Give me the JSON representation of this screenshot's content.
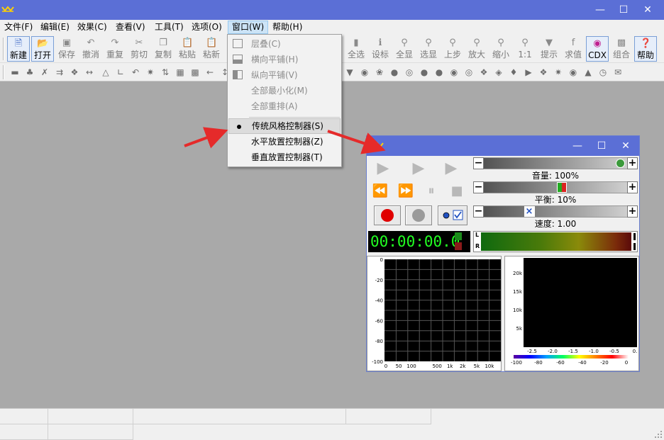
{
  "menubar": {
    "items": [
      "文件(F)",
      "编辑(E)",
      "效果(C)",
      "查看(V)",
      "工具(T)",
      "选项(O)",
      "窗口(W)",
      "帮助(H)"
    ]
  },
  "toolbar": {
    "buttons": [
      "新建",
      "打开",
      "保存",
      "撤消",
      "重复",
      "剪切",
      "复制",
      "粘贴",
      "粘新"
    ],
    "buttons_right": [
      "全选",
      "设标",
      "全显",
      "选显",
      "上步",
      "放大",
      "缩小",
      "1:1",
      "提示",
      "求值",
      "CDX",
      "组合",
      "帮助"
    ]
  },
  "window_menu": {
    "items": [
      {
        "label": "层叠(C)",
        "enabled": false
      },
      {
        "label": "横向平铺(H)",
        "enabled": false
      },
      {
        "label": "纵向平铺(V)",
        "enabled": false
      },
      {
        "label": "全部最小化(M)",
        "enabled": false
      },
      {
        "label": "全部重排(A)",
        "enabled": false
      },
      {
        "label": "传统风格控制器(S)",
        "enabled": true,
        "checked": true
      },
      {
        "label": "水平放置控制器(Z)",
        "enabled": true
      },
      {
        "label": "垂直放置控制器(T)",
        "enabled": true
      }
    ]
  },
  "controller": {
    "volume": {
      "label": "音量: 100%",
      "value": 1.0
    },
    "balance": {
      "label": "平衡: 10%",
      "value": 0.1
    },
    "speed": {
      "label": "速度: 1.00",
      "value": 1.0
    },
    "time": "00:00:00.0",
    "channel_l": "L",
    "channel_r": "R",
    "spectrum_y_ticks": [
      "0",
      "-20",
      "-40",
      "-60",
      "-80",
      "-100"
    ],
    "spectrum_x_ticks": [
      "0",
      "50",
      "100",
      "500",
      "1k",
      "2k",
      "5k",
      "10k"
    ],
    "freq_y_ticks": [
      "20k",
      "15k",
      "10k",
      "5k"
    ],
    "freq_x_ticks": [
      "-2.5",
      "-2.0",
      "-1.5",
      "-1.0",
      "-0.5",
      "0."
    ],
    "color_scale_ticks": [
      "-100",
      "-80",
      "-60",
      "-40",
      "-20",
      "0"
    ]
  },
  "colors": {
    "titlebar": "#5b6fd6",
    "time_text": "#22ff22",
    "record": "#e00000"
  }
}
